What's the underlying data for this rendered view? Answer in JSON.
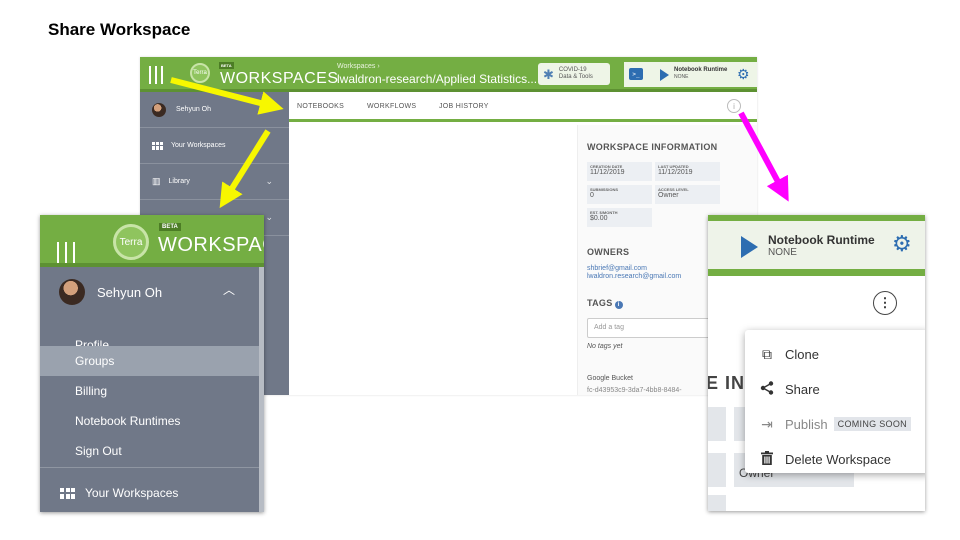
{
  "slide_title": "Share Workspace",
  "main": {
    "app_logo": "Terra",
    "beta_label": "BETA",
    "app_name": "WORKSPACES",
    "breadcrumb_small": "Workspaces ›",
    "breadcrumb_main": "lwaldron-research/Applied Statistics...",
    "covid_line1": "COVID-19",
    "covid_line2": "Data & Tools",
    "terminal_glyph": ">_",
    "runtime_label": "Notebook Runtime",
    "runtime_status": "NONE",
    "sidebar": {
      "user": "Sehyun Oh",
      "items": [
        "Your Workspaces",
        "Library"
      ]
    },
    "tabs": [
      "NOTEBOOKS",
      "WORKFLOWS",
      "JOB HISTORY"
    ],
    "info_glyph": "i",
    "workspace_info": {
      "heading": "WORKSPACE INFORMATION",
      "cells": [
        {
          "key": "CREATION DATE",
          "value": "11/12/2019"
        },
        {
          "key": "LAST UPDATED",
          "value": "11/12/2019"
        },
        {
          "key": "SUBMISSIONS",
          "value": "0"
        },
        {
          "key": "ACCESS LEVEL",
          "value": "Owner"
        },
        {
          "key": "EST. $/MONTH",
          "value": "$0.00"
        }
      ]
    },
    "owners_heading": "OWNERS",
    "owners": [
      "shbrief@gmail.com",
      "lwaldron.research@gmail.com"
    ],
    "tags_heading": "TAGS",
    "tags_placeholder": "Add a tag",
    "no_tags": "No tags yet",
    "bucket_heading": "Google Bucket",
    "bucket_id": "fc-d43953c9-3da7-4bb8-8484-"
  },
  "menu": {
    "logo": "Terra",
    "beta_label": "BETA",
    "app_name": "WORKSPACES",
    "user": "Sehyun Oh",
    "items": [
      "Profile",
      "Groups",
      "Billing",
      "Notebook Runtimes",
      "Sign Out"
    ],
    "active_item": "Groups",
    "your_workspaces": "Your Workspaces"
  },
  "right_panel": {
    "runtime_label": "Notebook Runtime",
    "runtime_status": "NONE",
    "kebab_glyph": "⋮",
    "partial_heading": "E INF",
    "partial_owner": "Owner",
    "menu_items": [
      {
        "label": "Clone",
        "icon": "clone-icon"
      },
      {
        "label": "Share",
        "icon": "share-icon"
      },
      {
        "label": "Publish",
        "icon": "publish-icon",
        "badge": "COMING SOON"
      },
      {
        "label": "Delete Workspace",
        "icon": "trash-icon"
      }
    ]
  },
  "colors": {
    "terra_green": "#74ae43",
    "sidebar_gray": "#707888",
    "accent_blue": "#2d6db1",
    "arrow_yellow": "#f7f700",
    "arrow_magenta": "#ff00ff"
  }
}
